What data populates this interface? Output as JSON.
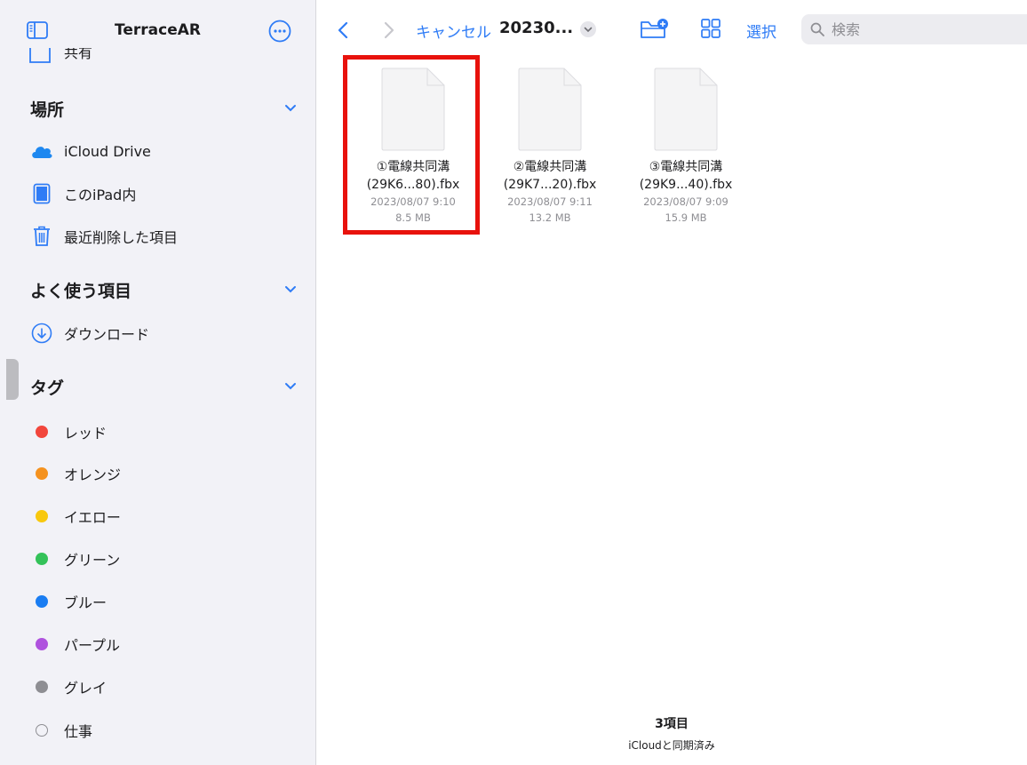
{
  "sidebar": {
    "title": "TerraceAR",
    "shared_label": "共有",
    "locations": {
      "title": "場所",
      "items": [
        {
          "label": "iCloud Drive",
          "icon": "icloud-icon"
        },
        {
          "label": "このiPad内",
          "icon": "ipad-icon"
        },
        {
          "label": "最近削除した項目",
          "icon": "trash-icon"
        }
      ]
    },
    "favorites": {
      "title": "よく使う項目",
      "items": [
        {
          "label": "ダウンロード",
          "icon": "download-icon"
        }
      ]
    },
    "tags": {
      "title": "タグ",
      "items": [
        {
          "label": "レッド",
          "color": "#f2463c"
        },
        {
          "label": "オレンジ",
          "color": "#f5921f"
        },
        {
          "label": "イエロー",
          "color": "#f8c80e"
        },
        {
          "label": "グリーン",
          "color": "#34c259"
        },
        {
          "label": "ブルー",
          "color": "#1a7df2"
        },
        {
          "label": "パープル",
          "color": "#af52de"
        },
        {
          "label": "グレイ",
          "color": "#8e8e93"
        },
        {
          "label": "仕事",
          "color": ""
        }
      ]
    }
  },
  "toolbar": {
    "breadcrumb": "キャンセル",
    "folder_title": "20230...",
    "select_label": "選択",
    "search_placeholder": "検索"
  },
  "files": [
    {
      "name_line1": "①電線共同溝",
      "name_line2": "(29K6...80).fbx",
      "date": "2023/08/07 9:10",
      "size": "8.5 MB",
      "selected": true
    },
    {
      "name_line1": "②電線共同溝",
      "name_line2": "(29K7...20).fbx",
      "date": "2023/08/07 9:11",
      "size": "13.2 MB",
      "selected": false
    },
    {
      "name_line1": "③電線共同溝",
      "name_line2": "(29K9...40).fbx",
      "date": "2023/08/07 9:09",
      "size": "15.9 MB",
      "selected": false
    }
  ],
  "footer": {
    "count": "3項目",
    "sync_status": "iCloudと同期済み"
  },
  "colors": {
    "accent": "#2f7cf6",
    "highlight": "#e8120c"
  }
}
